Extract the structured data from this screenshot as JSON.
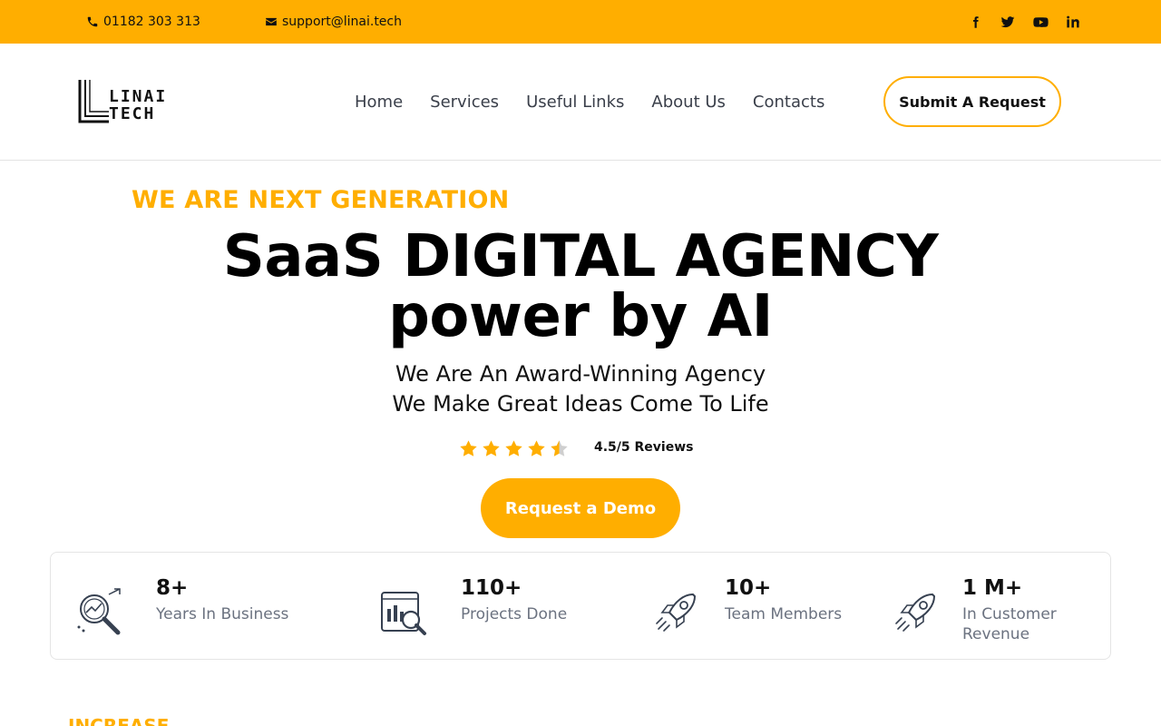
{
  "topbar": {
    "phone": "01182 303 313",
    "email": "support@linai.tech",
    "socials": [
      "facebook-icon",
      "twitter-icon",
      "youtube-icon",
      "linkedin-icon"
    ],
    "background": "#FFAE00"
  },
  "header": {
    "logo_line1": "LINAI",
    "logo_line2": "TECH",
    "nav": [
      "Home",
      "Services",
      "Useful Links",
      "About Us",
      "Contacts"
    ],
    "submit_label": "Submit A Request"
  },
  "hero": {
    "eyebrow": "WE ARE NEXT GENERATION",
    "headline_line1": "SaaS DIGITAL AGENCY",
    "headline_line2": "power by AI",
    "sub_line1": "We Are An Award-Winning Agency",
    "sub_line2": "We Make Great Ideas Come To Life",
    "rating": 4.5,
    "reviews_text": "4.5/5 Reviews",
    "demo_label": "Request a Demo",
    "accent": "#FFAE00"
  },
  "stats": [
    {
      "value": "8+",
      "label": "Years In Business",
      "icon": "analytics-search-icon"
    },
    {
      "value": "110+",
      "label": "Projects Done",
      "icon": "dashboard-search-icon"
    },
    {
      "value": "10+",
      "label": "Team Members",
      "icon": "rocket-icon"
    },
    {
      "value": "1 M+",
      "label": "In Customer Revenue",
      "icon": "rocket-icon"
    }
  ],
  "next_section": {
    "eyebrow": "INCREASE"
  }
}
